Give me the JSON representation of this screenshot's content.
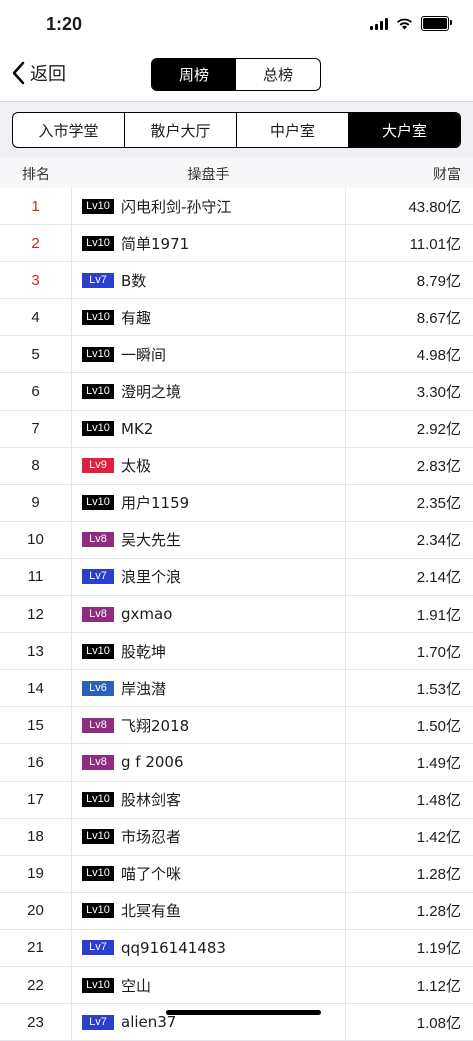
{
  "status": {
    "time": "1:20"
  },
  "nav": {
    "back_label": "返回",
    "period_tabs": [
      "周榜",
      "总榜"
    ],
    "active_period": 0
  },
  "category_tabs": {
    "labels": [
      "入市学堂",
      "散户大厅",
      "中户室",
      "大户室"
    ],
    "active": 3
  },
  "table": {
    "headers": {
      "rank": "排名",
      "trader": "操盘手",
      "wealth": "财富"
    },
    "rows": [
      {
        "rank": "1",
        "level": "Lv10",
        "level_color": "#000000",
        "name": "闪电利剑-孙守江",
        "wealth": "43.80亿"
      },
      {
        "rank": "2",
        "level": "Lv10",
        "level_color": "#000000",
        "name": "简单1971",
        "wealth": "11.01亿"
      },
      {
        "rank": "3",
        "level": "Lv7",
        "level_color": "#2b3fcf",
        "name": "B数",
        "wealth": "8.79亿"
      },
      {
        "rank": "4",
        "level": "Lv10",
        "level_color": "#000000",
        "name": "有趣",
        "wealth": "8.67亿"
      },
      {
        "rank": "5",
        "level": "Lv10",
        "level_color": "#000000",
        "name": "一瞬间",
        "wealth": "4.98亿"
      },
      {
        "rank": "6",
        "level": "Lv10",
        "level_color": "#000000",
        "name": "澄明之境",
        "wealth": "3.30亿"
      },
      {
        "rank": "7",
        "level": "Lv10",
        "level_color": "#000000",
        "name": "MK2",
        "wealth": "2.92亿"
      },
      {
        "rank": "8",
        "level": "Lv9",
        "level_color": "#e0203c",
        "name": "太极",
        "wealth": "2.83亿"
      },
      {
        "rank": "9",
        "level": "Lv10",
        "level_color": "#000000",
        "name": "用户1159",
        "wealth": "2.35亿"
      },
      {
        "rank": "10",
        "level": "Lv8",
        "level_color": "#8e2c80",
        "name": "吴大先生",
        "wealth": "2.34亿"
      },
      {
        "rank": "11",
        "level": "Lv7",
        "level_color": "#2b3fcf",
        "name": "浪里个浪",
        "wealth": "2.14亿"
      },
      {
        "rank": "12",
        "level": "Lv8",
        "level_color": "#8e2c80",
        "name": "gxmao",
        "wealth": "1.91亿"
      },
      {
        "rank": "13",
        "level": "Lv10",
        "level_color": "#000000",
        "name": "股乾坤",
        "wealth": "1.70亿"
      },
      {
        "rank": "14",
        "level": "Lv6",
        "level_color": "#2b62b8",
        "name": "岸浊潜",
        "wealth": "1.53亿"
      },
      {
        "rank": "15",
        "level": "Lv8",
        "level_color": "#8e2c80",
        "name": "飞翔2018",
        "wealth": "1.50亿"
      },
      {
        "rank": "16",
        "level": "Lv8",
        "level_color": "#8e2c80",
        "name": "g f 2006",
        "wealth": "1.49亿"
      },
      {
        "rank": "17",
        "level": "Lv10",
        "level_color": "#000000",
        "name": "股林剑客",
        "wealth": "1.48亿"
      },
      {
        "rank": "18",
        "level": "Lv10",
        "level_color": "#000000",
        "name": "市场忍者",
        "wealth": "1.42亿"
      },
      {
        "rank": "19",
        "level": "Lv10",
        "level_color": "#000000",
        "name": "喵了个咪",
        "wealth": "1.28亿"
      },
      {
        "rank": "20",
        "level": "Lv10",
        "level_color": "#000000",
        "name": "北冥有鱼",
        "wealth": "1.28亿"
      },
      {
        "rank": "21",
        "level": "Lv7",
        "level_color": "#2b3fcf",
        "name": "qq916141483",
        "wealth": "1.19亿"
      },
      {
        "rank": "22",
        "level": "Lv10",
        "level_color": "#000000",
        "name": "空山",
        "wealth": "1.12亿"
      },
      {
        "rank": "23",
        "level": "Lv7",
        "level_color": "#2b3fcf",
        "name": "alien37",
        "wealth": "1.08亿"
      }
    ]
  },
  "colors": {
    "top_rank": "#e02020",
    "tab_strip_bg": "#efeff4"
  }
}
